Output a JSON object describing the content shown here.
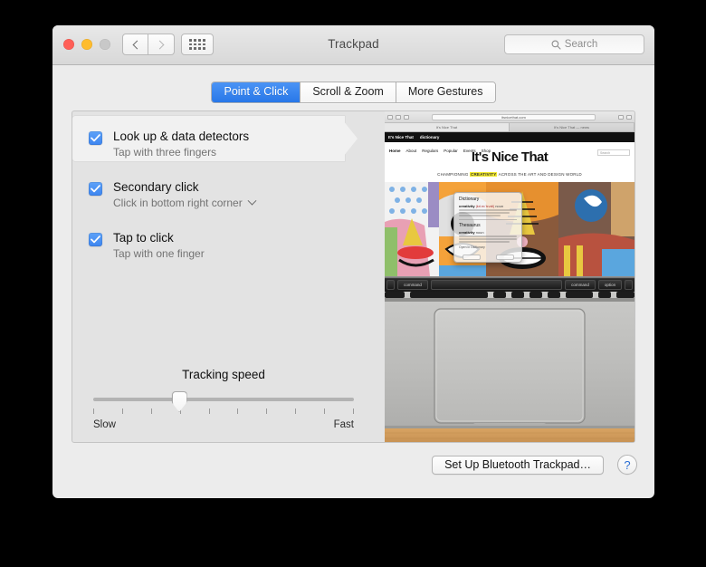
{
  "window": {
    "title": "Trackpad",
    "traffic_lights": [
      "close",
      "minimize",
      "zoom"
    ],
    "nav_back_icon": "chevron-left-icon",
    "nav_forward_icon": "chevron-right-icon",
    "show_all_icon": "grid-icon"
  },
  "search": {
    "placeholder": "Search",
    "icon": "search-icon"
  },
  "tabs": [
    {
      "label": "Point & Click",
      "active": true
    },
    {
      "label": "Scroll & Zoom",
      "active": false
    },
    {
      "label": "More Gestures",
      "active": false
    }
  ],
  "options": [
    {
      "title": "Look up & data detectors",
      "subtitle": "Tap with three fingers",
      "checked": true,
      "selected": true,
      "has_popup": false
    },
    {
      "title": "Secondary click",
      "subtitle": "Click in bottom right corner",
      "checked": true,
      "selected": false,
      "has_popup": true,
      "popup_icon": "chevron-down-icon"
    },
    {
      "title": "Tap to click",
      "subtitle": "Tap with one finger",
      "checked": true,
      "selected": false,
      "has_popup": false
    }
  ],
  "slider": {
    "label": "Tracking speed",
    "min_label": "Slow",
    "max_label": "Fast",
    "tick_count": 10,
    "value_percent": 33
  },
  "preview": {
    "browser": {
      "url": "itsnicethat.com",
      "tabs": [
        "It's Nice That",
        "It's Nice That — news"
      ],
      "site_nav": [
        "It's Nice That",
        "dictionary"
      ],
      "menu": [
        "Home",
        "About",
        "Regulars",
        "Popular",
        "Events",
        "Shop"
      ],
      "logo": "It's Nice That",
      "search_placeholder": "Search",
      "tagline_before": "CHAMPIONING ",
      "tagline_highlight": "CREATIVITY",
      "tagline_after": " ACROSS THE ART AND DESIGN WORLD"
    },
    "dictionary_popup": {
      "dictionary_heading": "Dictionary",
      "thesaurus_heading": "Thesaurus",
      "word": "creativity",
      "pronunciation": "|kriːeɪˈtɪvɪti|",
      "part_of_speech": "noun",
      "footer": "Open in Dictionary",
      "buttons": [
        "Dictionary",
        "Thesaurus"
      ]
    },
    "keyboard_keys": [
      "command",
      "",
      "command",
      "option"
    ]
  },
  "bottom": {
    "setup_button": "Set Up Bluetooth Trackpad…",
    "help_button": "?"
  },
  "colors": {
    "accent_blue": "#2877e8",
    "checkbox_blue": "#3d85f0",
    "window_bg": "#ececec",
    "panel_bg": "#e3e3e3",
    "selected_row": "#f1f1f1",
    "highlight_yellow": "#f2ea2e"
  }
}
